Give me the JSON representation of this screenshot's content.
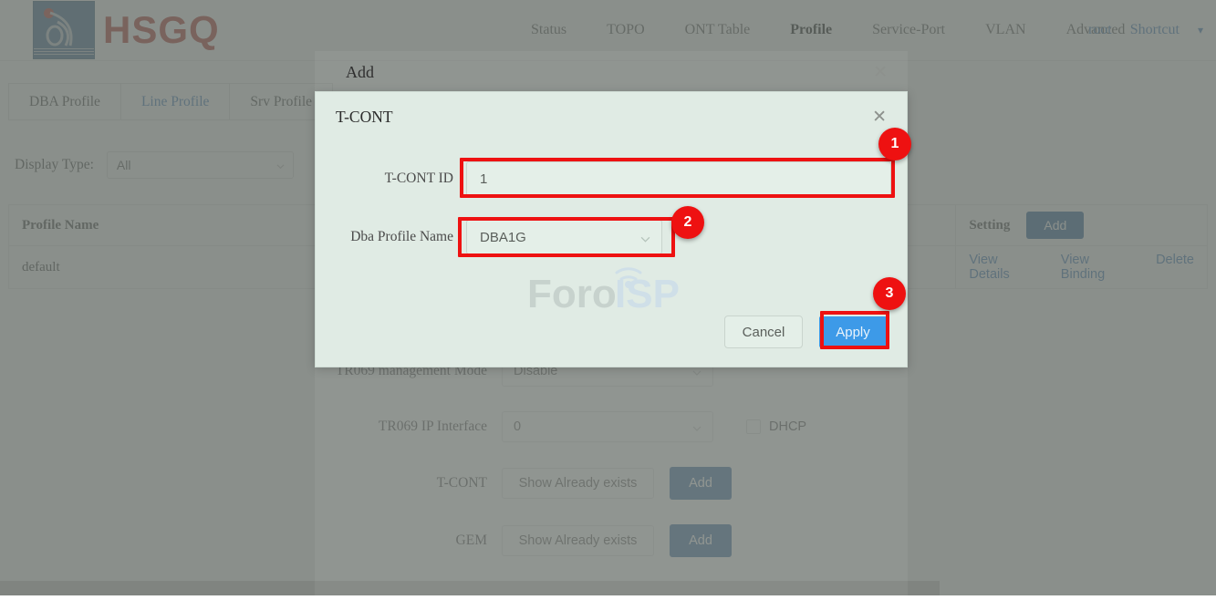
{
  "header": {
    "brand": "HSGQ",
    "nav_items": [
      {
        "label": "Status",
        "active": false
      },
      {
        "label": "TOPO",
        "active": false
      },
      {
        "label": "ONT Table",
        "active": false
      },
      {
        "label": "Profile",
        "active": true
      },
      {
        "label": "Service-Port",
        "active": false
      },
      {
        "label": "VLAN",
        "active": false
      },
      {
        "label": "Advanced",
        "active": false
      }
    ],
    "user": "root",
    "shortcut": "Shortcut",
    "shortcut_caret": "chevron-down-icon"
  },
  "tabs": [
    {
      "label": "DBA Profile",
      "active": false
    },
    {
      "label": "Line Profile",
      "active": true
    },
    {
      "label": "Srv Profile",
      "active": false
    }
  ],
  "filter": {
    "label": "Display Type:",
    "value": "All"
  },
  "table": {
    "columns": [
      "Profile Name",
      "Setting"
    ],
    "header_add_button": "Add",
    "rows": [
      {
        "profile_name": "default",
        "actions": [
          "View Details",
          "View Binding",
          "Delete"
        ]
      }
    ]
  },
  "background_form": {
    "rows": [
      {
        "label": "TR069 management Mode",
        "value": "Disable",
        "type": "select"
      },
      {
        "label": "TR069 IP Interface",
        "value": "0",
        "type": "select",
        "checkbox_label": "DHCP",
        "checkbox_checked": false
      },
      {
        "label": "T-CONT",
        "value": "Show Already exists",
        "type": "button",
        "add_label": "Add"
      },
      {
        "label": "GEM",
        "value": "Show Already exists",
        "type": "button",
        "add_label": "Add"
      }
    ]
  },
  "modal_outer": {
    "title": "Add",
    "close_icon": "close-icon"
  },
  "dialog": {
    "title": "T-CONT",
    "close_icon": "close-icon",
    "fields": [
      {
        "label": "T-CONT ID",
        "value": "1",
        "type": "text"
      },
      {
        "label": "Dba Profile Name",
        "value": "DBA1G",
        "type": "select"
      }
    ],
    "cancel_label": "Cancel",
    "apply_label": "Apply"
  },
  "watermark": {
    "text_left": "Foro",
    "text_right": "ISP"
  },
  "annotations": [
    {
      "number": "1",
      "target": "T-CONT ID input"
    },
    {
      "number": "2",
      "target": "Dba Profile Name select"
    },
    {
      "number": "3",
      "target": "Apply button"
    }
  ],
  "colors": {
    "brand_red": "#a8231b",
    "logo_blue": "#2f5b85",
    "link_blue": "#2f6fb5",
    "button_blue": "#1d5591",
    "apply_blue": "#3d9ae8",
    "annotation_red": "#ee1111",
    "dialog_bg": "#e0ebe4",
    "overlay_gray": "#6d736e"
  }
}
